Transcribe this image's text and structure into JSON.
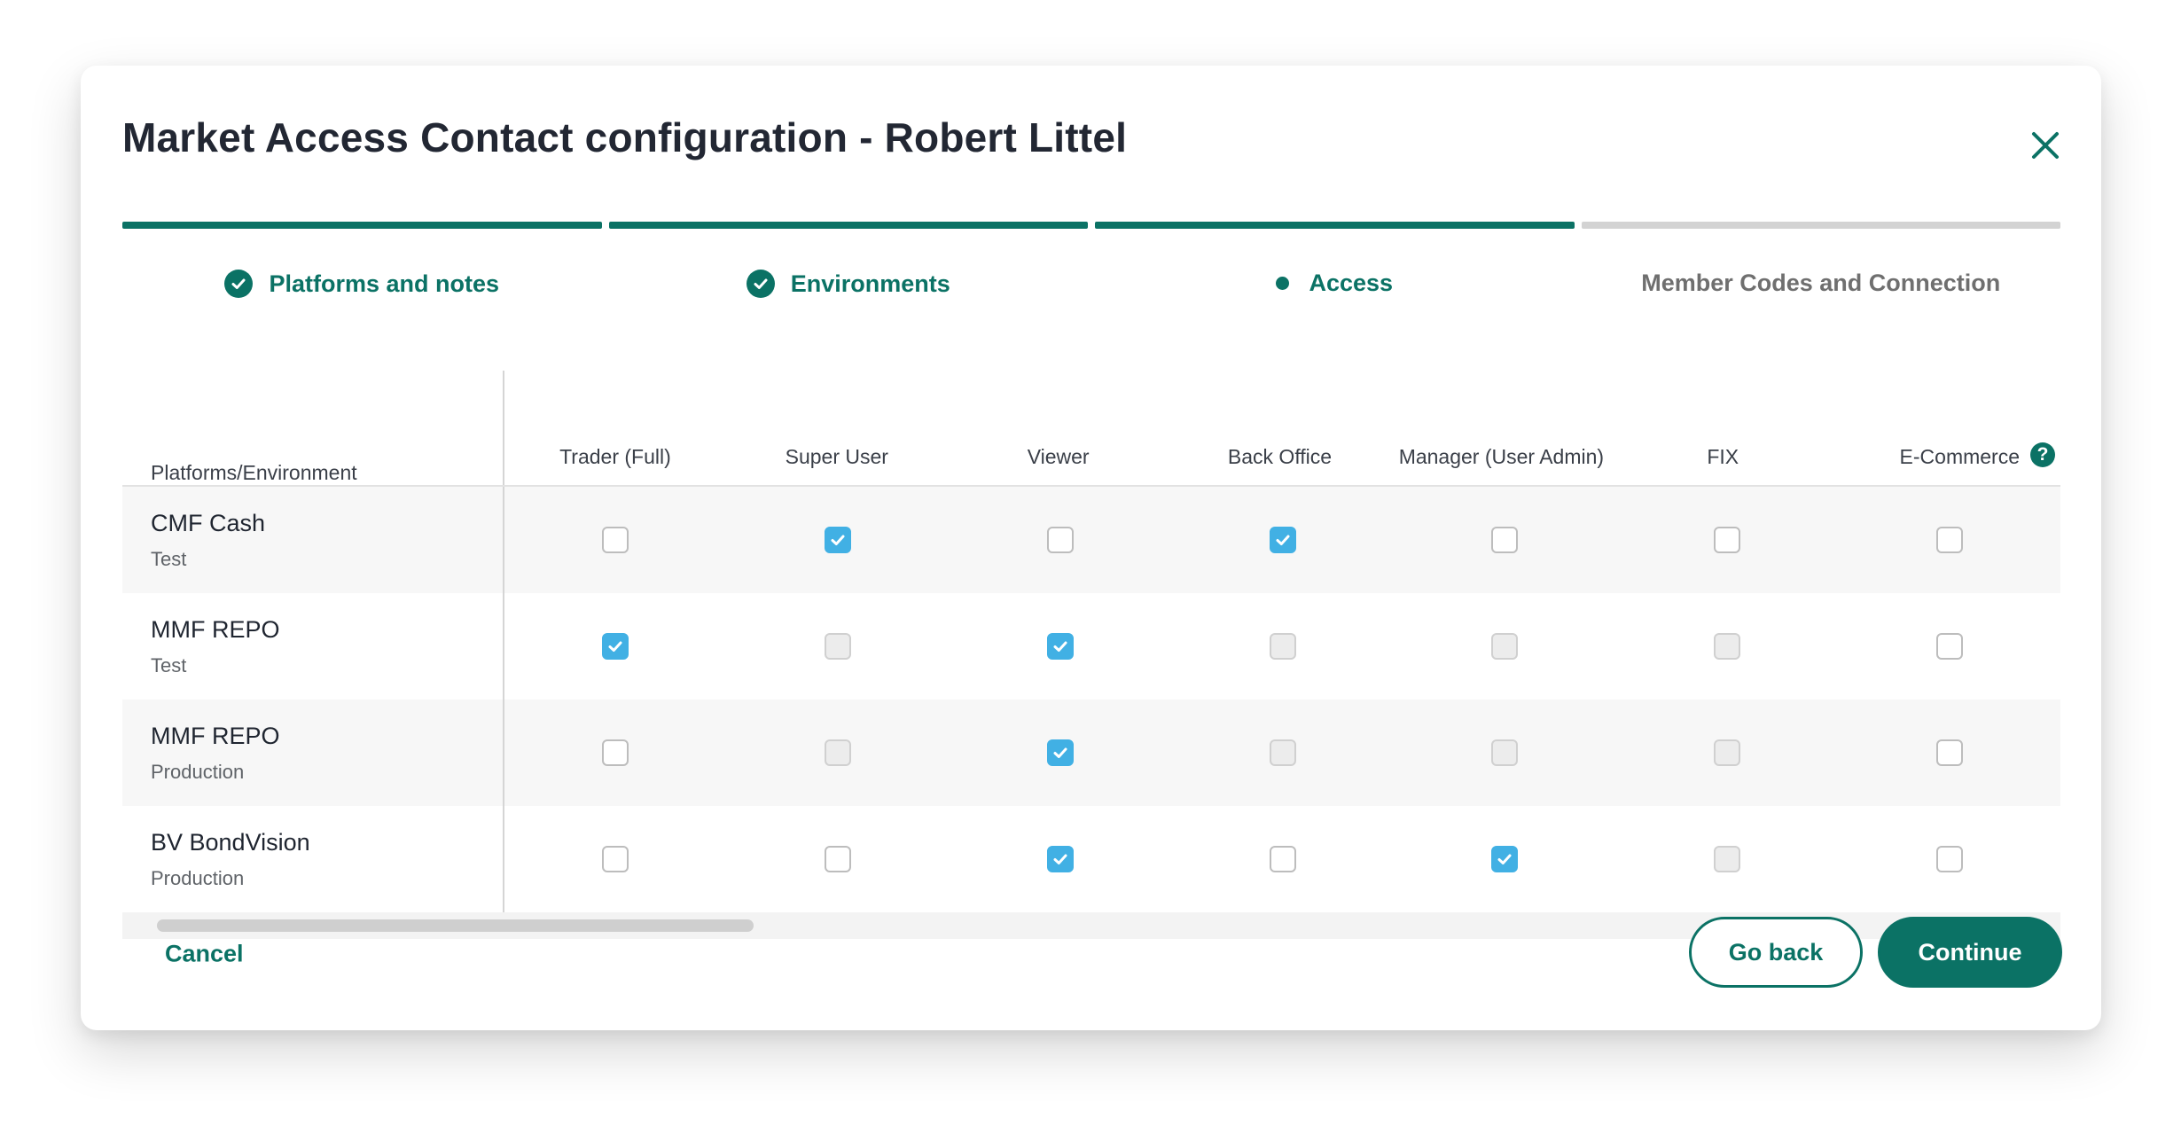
{
  "modal": {
    "title": "Market Access Contact configuration - Robert Littel"
  },
  "steps": [
    {
      "label": "Platforms and notes",
      "state": "done"
    },
    {
      "label": "Environments",
      "state": "done"
    },
    {
      "label": "Access",
      "state": "active"
    },
    {
      "label": "Member Codes and Connection",
      "state": "pending"
    }
  ],
  "table": {
    "first_header": "Platforms/Environment",
    "headers": [
      "Trader (Full)",
      "Super User",
      "Viewer",
      "Back Office",
      "Manager (User Admin)",
      "FIX",
      "E-Commerce"
    ],
    "rows": [
      {
        "platform": "CMF Cash",
        "environment": "Test",
        "cells": [
          "unchecked",
          "checked",
          "unchecked",
          "checked",
          "unchecked",
          "unchecked",
          "unchecked"
        ]
      },
      {
        "platform": "MMF REPO",
        "environment": "Test",
        "cells": [
          "checked",
          "disabled",
          "checked",
          "disabled",
          "disabled",
          "disabled",
          "unchecked"
        ]
      },
      {
        "platform": "MMF REPO",
        "environment": "Production",
        "cells": [
          "unchecked",
          "disabled",
          "checked",
          "disabled",
          "disabled",
          "disabled",
          "unchecked"
        ]
      },
      {
        "platform": "BV BondVision",
        "environment": "Production",
        "cells": [
          "unchecked",
          "unchecked",
          "checked",
          "unchecked",
          "checked",
          "disabled",
          "unchecked"
        ]
      }
    ]
  },
  "footer": {
    "cancel_label": "Cancel",
    "back_label": "Go back",
    "continue_label": "Continue"
  },
  "colors": {
    "accent": "#0b7265",
    "checkbox_checked": "#41b0e4",
    "step_pending": "#d3d3d3"
  },
  "icons": {
    "close": "close-icon",
    "step_done": "check-circle-icon",
    "step_active": "dot-icon",
    "help": "help-icon",
    "checkbox_tick": "checkmark-icon"
  }
}
